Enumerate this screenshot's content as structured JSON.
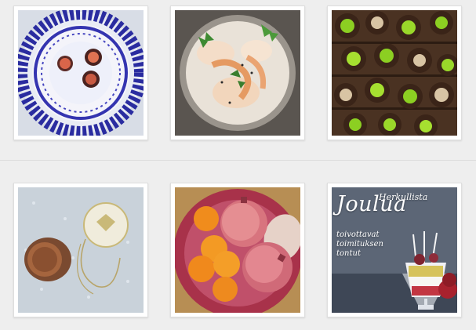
{
  "gallery": {
    "items": [
      {
        "subject": "blue-floral-plate-with-bites"
      },
      {
        "subject": "shrimp-dish-with-herbs"
      },
      {
        "subject": "chocolate-cups-with-green-topping"
      },
      {
        "subject": "champagne-cork-on-snow"
      },
      {
        "subject": "bowl-of-pomegranates-and-clementines"
      },
      {
        "subject": "christmas-recipe-poster"
      }
    ]
  },
  "poster": {
    "kicker": "Herkullista",
    "title": "Joulua",
    "subtitle_lines": [
      "toivottavat",
      "toimituksen",
      "tontut"
    ]
  },
  "colors": {
    "page_bg": "#eeeeee",
    "card_bg": "#ffffff",
    "divider": "#dcdcdc"
  }
}
